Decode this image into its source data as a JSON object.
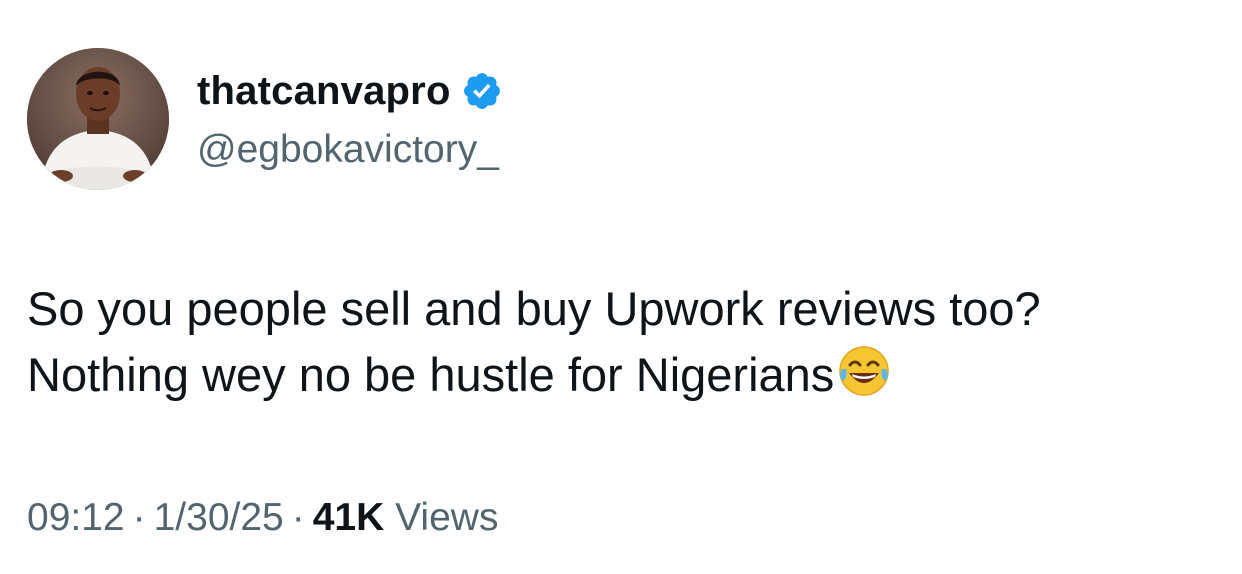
{
  "author": {
    "display_name": "thatcanvapro",
    "handle": "@egbokavictory_",
    "verified": true,
    "verified_color": "#1d9bf0",
    "avatar_icon": "profile-photo"
  },
  "tweet": {
    "line1": "So you people sell and buy Upwork reviews too?",
    "line2": "Nothing wey no be hustle for Nigerians",
    "emoji": "face-with-tears-of-joy"
  },
  "meta": {
    "time": "09:12",
    "date": "1/30/25",
    "separator": "·",
    "views_count": "41K",
    "views_label": "Views"
  },
  "colors": {
    "text": "#0f1419",
    "secondary": "#536471",
    "background": "#ffffff"
  }
}
